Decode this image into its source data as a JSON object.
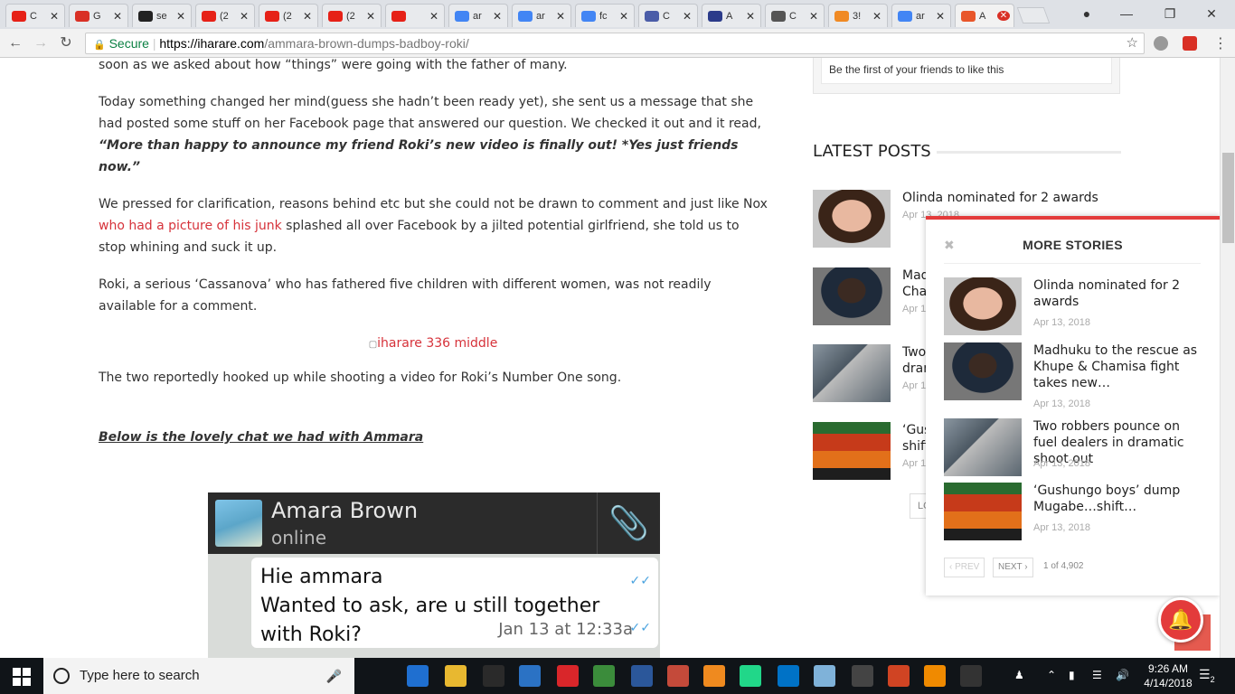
{
  "browser": {
    "tabs": [
      {
        "title": "C",
        "favicon": "youtube-icon",
        "color": "#e62117"
      },
      {
        "title": "G",
        "favicon": "gmail-icon",
        "color": "#d93025"
      },
      {
        "title": "se",
        "favicon": "github-icon",
        "color": "#222222"
      },
      {
        "title": "(2",
        "favicon": "youtube-icon",
        "color": "#e62117"
      },
      {
        "title": "(2",
        "favicon": "youtube-icon",
        "color": "#e62117"
      },
      {
        "title": "(2",
        "favicon": "youtube-icon",
        "color": "#e62117"
      },
      {
        "title": "",
        "favicon": "youtube-audio-icon",
        "color": "#e62117"
      },
      {
        "title": "ar",
        "favicon": "google-icon",
        "color": "#4285f4"
      },
      {
        "title": "ar",
        "favicon": "google-icon",
        "color": "#4285f4"
      },
      {
        "title": "fc",
        "favicon": "google-icon",
        "color": "#4285f4"
      },
      {
        "title": "C",
        "favicon": "shield-icon",
        "color": "#4a5ca8"
      },
      {
        "title": "A",
        "favicon": "s-icon",
        "color": "#2b3b8a"
      },
      {
        "title": "C",
        "favicon": "wikipedia-icon",
        "color": "#555555"
      },
      {
        "title": "3!",
        "favicon": "her-icon",
        "color": "#f08a24"
      },
      {
        "title": "ar",
        "favicon": "google-icon",
        "color": "#4285f4"
      },
      {
        "title": "A",
        "favicon": "fire-icon",
        "color": "#e8562a"
      }
    ],
    "address": {
      "secure_label": "Secure",
      "host": "https://iharare.com",
      "path": "/ammara-brown-dumps-badboy-roki/"
    }
  },
  "article": {
    "p0": "soon as we asked about how “things” were going with the father of many.",
    "p1_text": "Today something changed her mind(guess she hadn’t been ready yet), she sent us a message that she had posted some stuff on her Facebook page that answered our question. We checked it out and it read, ",
    "p1_quote": "“More than happy to announce my friend Roki’s new video is finally out! *Yes just friends now.”",
    "p2_a": "We pressed for clarification, reasons behind etc but she could not be drawn to comment and just like Nox ",
    "p2_link": "who had a picture of his junk",
    "p2_b": " splashed all over Facebook by a jilted potential girlfriend, she told us to stop whining and suck it up.",
    "p3": "Roki, a serious ‘Cassanova’ who has fathered five children with different women, was not readily available for a comment.",
    "ad_alt": "iharare 336 middle",
    "p4": "The two reportedly hooked up while shooting a video for Roki’s Number One song.",
    "p5": "Below is the lovely chat we had with Ammara",
    "chat": {
      "name": "Amara Brown",
      "status": "online",
      "line1": "Hie ammara",
      "line2": "Wanted to ask, are u still together with Roki?",
      "time": "Jan 13 at 12:33a"
    }
  },
  "sidebar": {
    "fb_text": "Be the first of your friends to like this",
    "latest_title": "LATEST POSTS",
    "latest": [
      {
        "title": "Olinda nominated for 2 awards",
        "date": "Apr 13, 2018"
      },
      {
        "title": "Mad",
        "title2": "Cha",
        "date": "Apr 1"
      },
      {
        "title": "Two",
        "title2": "dran",
        "date": "Apr 1"
      },
      {
        "title": "‘Gus",
        "title2": "shift",
        "date": "Apr 1"
      }
    ],
    "pager": "LO"
  },
  "more_stories": {
    "title": "MORE STORIES",
    "items": [
      {
        "title": "Olinda nominated for 2 awards",
        "date": "Apr 13, 2018"
      },
      {
        "title": "Madhuku to the rescue as Khupe & Chamisa fight takes new…",
        "date": "Apr 13, 2018"
      },
      {
        "title": "Two robbers pounce on fuel dealers in dramatic shoot out",
        "date": "Apr 13, 2018"
      },
      {
        "title": "‘Gushungo boys’ dump Mugabe…shift…",
        "date": "Apr 13, 2018"
      }
    ],
    "prev": "‹ PREV",
    "next": "NEXT ›",
    "count": "1 of 4,902"
  },
  "taskbar": {
    "search_placeholder": "Type here to search",
    "time": "9:26 AM",
    "date": "4/14/2018",
    "notifications": "2"
  }
}
